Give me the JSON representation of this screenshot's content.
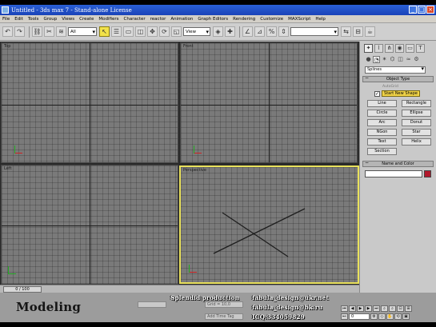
{
  "window": {
    "title": "Untitled - 3ds max 7 - Stand-alone License",
    "controls": [
      "_",
      "□",
      "×"
    ]
  },
  "menu": [
    "File",
    "Edit",
    "Tools",
    "Group",
    "Views",
    "Create",
    "Modifiers",
    "Character",
    "reactor",
    "Animation",
    "Graph Editors",
    "Rendering",
    "Customize",
    "MAXScript",
    "Help"
  ],
  "toolbar": {
    "selection_filter": "All",
    "ref_coord": "View",
    "named_selection": ""
  },
  "viewports": {
    "top": "Top",
    "front": "Front",
    "left": "Left",
    "perspective": "Perspective"
  },
  "timebar": {
    "slider_label": "0 / 100"
  },
  "status": {
    "field1": "",
    "field2": "Grid = 10,0",
    "field3": "Add Time Tag"
  },
  "overlay": {
    "title": "Modeling",
    "credits": {
      "col1": [
        "Splendid production",
        "",
        ""
      ],
      "col2": [
        "fabula_design@ukr.net",
        "fabula_design@bk.ru",
        "ICQ:334059829"
      ]
    }
  },
  "playback": {
    "frame": "0"
  },
  "command_panel": {
    "category": "Splines",
    "rollout_object_type": "Object Type",
    "autogrid": "AutoGrid",
    "start_new_shape": "Start New Shape",
    "start_new_shape_checked": "✓",
    "objects": [
      "Line",
      "Rectangle",
      "Circle",
      "Ellipse",
      "Arc",
      "Donut",
      "NGon",
      "Star",
      "Text",
      "Helix",
      "Section"
    ],
    "rollout_name_color": "Name and Color",
    "swatch_color": "#b2182b"
  }
}
